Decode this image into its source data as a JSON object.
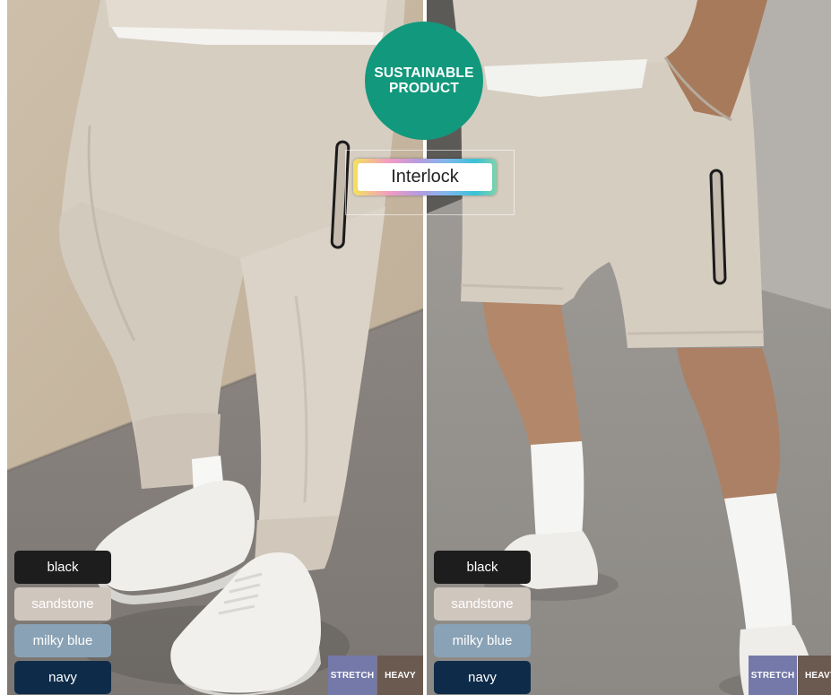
{
  "badge": {
    "line1": "SUSTAINABLE",
    "line2": "PRODUCT",
    "color": "#12987c"
  },
  "fabric_label": {
    "text": "Interlock"
  },
  "panels": [
    {
      "swatches": [
        {
          "label": "black",
          "color": "#1d1d1d"
        },
        {
          "label": "sandstone",
          "color": "#cfc6bd"
        },
        {
          "label": "milky blue",
          "color": "#8aa2b5"
        },
        {
          "label": "navy",
          "color": "#0e2c4a"
        }
      ],
      "tags": [
        {
          "label": "STRETCH",
          "color": "#7479aa"
        },
        {
          "label": "HEAVY",
          "color": "#6b5a50"
        }
      ]
    },
    {
      "swatches": [
        {
          "label": "black",
          "color": "#1d1d1d"
        },
        {
          "label": "sandstone",
          "color": "#cfc6bd"
        },
        {
          "label": "milky blue",
          "color": "#8aa2b5"
        },
        {
          "label": "navy",
          "color": "#0e2c4a"
        }
      ],
      "tags": [
        {
          "label": "STRETCH",
          "color": "#7479aa"
        },
        {
          "label": "HEAVY",
          "color": "#6b5a50"
        }
      ]
    }
  ]
}
